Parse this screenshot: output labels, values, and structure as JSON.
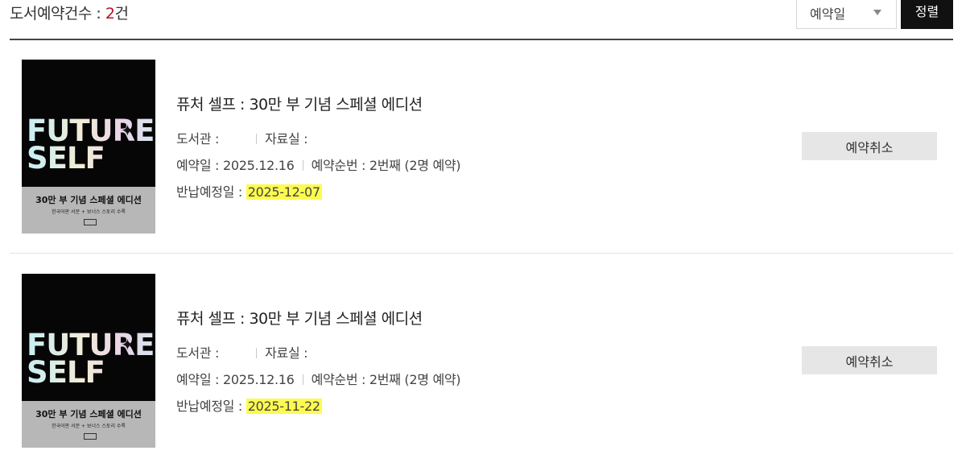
{
  "header": {
    "count_label": "도서예약건수 : ",
    "count_value": "2",
    "count_unit": "건",
    "sort_select_value": "예약일",
    "sort_button_label": "정렬"
  },
  "cover": {
    "big_text_line1": "FUTURE",
    "big_text_line2": "SELF",
    "band_title": "30만 부 기념 스페셜 에디션",
    "band_sub": "한국어판 서문 + 보너스 스토리 수록"
  },
  "items": [
    {
      "title": "퓨처 셀프 : 30만 부 기념 스페셜 에디션",
      "library_label": "도서관 :",
      "room_label": "자료실 :",
      "reserve_date_label": "예약일 : ",
      "reserve_date": "2025.12.16",
      "order_label": "예약순번 : ",
      "order_value": "2번째 (2명 예약)",
      "return_label": "반납예정일 : ",
      "return_date": "2025-12-07",
      "cancel_label": "예약취소"
    },
    {
      "title": "퓨처 셀프 : 30만 부 기념 스페셜 에디션",
      "library_label": "도서관 :",
      "room_label": "자료실 :",
      "reserve_date_label": "예약일 : ",
      "reserve_date": "2025.12.16",
      "order_label": "예약순번 : ",
      "order_value": "2번째 (2명 예약)",
      "return_label": "반납예정일 : ",
      "return_date": "2025-11-22",
      "cancel_label": "예약취소"
    }
  ],
  "colors": {
    "accent_count": "#b5122a",
    "highlight": "#fdfb4f",
    "sort_button_bg": "#111111"
  }
}
